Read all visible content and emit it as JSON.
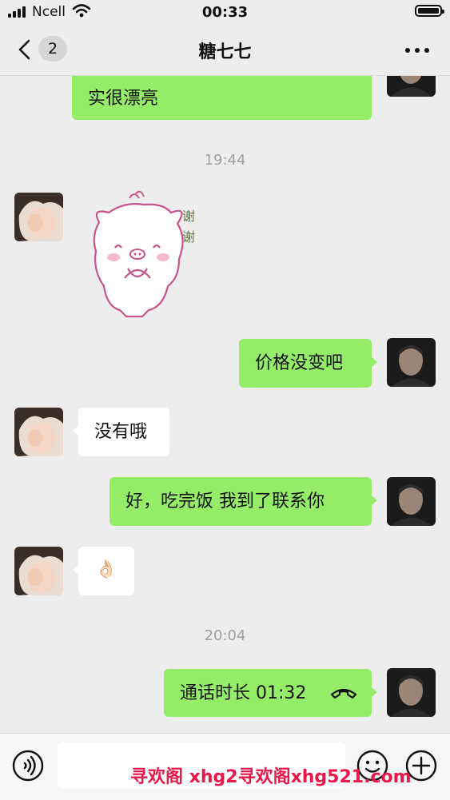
{
  "status_bar": {
    "carrier": "Ncell",
    "time": "00:33"
  },
  "header": {
    "badge_count": "2",
    "title": "糖七七"
  },
  "messages": {
    "m0": "实很漂亮",
    "ts1": "19:44",
    "sticker_text": "谢谢",
    "m1": "价格没变吧",
    "m2": "没有哦",
    "m3": "好，吃完饭 我到了联系你",
    "m4": "👌🏻",
    "ts2": "20:04",
    "call": "通话时长 01:32"
  },
  "watermark": "寻欢阁 xhg2寻欢阁xhg521.com",
  "colors": {
    "mine_bubble": "#95ec69",
    "theirs_bubble": "#ffffff",
    "background": "#ededed",
    "watermark": "#e8184b"
  },
  "icons": [
    "chevron-left-icon",
    "more-icon",
    "voice-icon",
    "emoji-icon",
    "plus-icon",
    "hangup-icon"
  ]
}
